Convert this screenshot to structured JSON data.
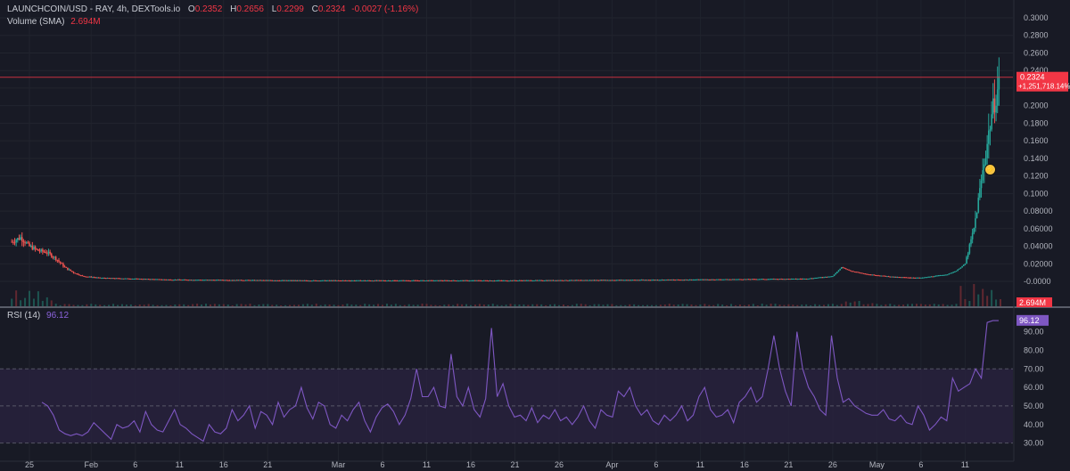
{
  "header": {
    "symbol": "LAUNCHCOIN/USD - RAY, 4h, DEXTools.io",
    "ohlc": [
      {
        "key": "O",
        "value": "0.2352"
      },
      {
        "key": "H",
        "value": "0.2656"
      },
      {
        "key": "L",
        "value": "0.2299"
      },
      {
        "key": "C",
        "value": "0.2324"
      }
    ],
    "change": "-0.0027 (-1.16%)",
    "volume_label": "Volume (SMA)",
    "volume_value": "2.694M",
    "rsi_label": "RSI (14)",
    "rsi_value": "96.12"
  },
  "price_axis": {
    "ticks": [
      "0.3000",
      "0.2800",
      "0.2600",
      "0.2400",
      "0.2200",
      "0.2000",
      "0.1800",
      "0.1600",
      "0.1400",
      "0.1200",
      "0.1000",
      "0.08000",
      "0.06000",
      "0.04000",
      "0.02000",
      "-0.0000"
    ],
    "current_price": "0.2324",
    "current_change": "+1,251,718.14%",
    "volume_badge": "2.694M"
  },
  "rsi_axis": {
    "ticks": [
      "90.00",
      "80.00",
      "70.00",
      "60.00",
      "50.00",
      "40.00",
      "30.00"
    ],
    "current": "96.12"
  },
  "time_axis": {
    "labels": [
      "25",
      "Feb",
      "6",
      "11",
      "16",
      "21",
      "Mar",
      "6",
      "11",
      "16",
      "21",
      "26",
      "Apr",
      "6",
      "11",
      "16",
      "21",
      "26",
      "May",
      "6",
      "11"
    ]
  },
  "colors": {
    "background": "#181a25",
    "up": "#26a69a",
    "down": "#ef5350",
    "rsi_line": "#7e57c2",
    "rsi_band": "#2a2340",
    "price_line": "#f23645"
  },
  "chart_data": [
    {
      "type": "candlestick",
      "title": "LAUNCHCOIN/USD - RAY, 4h, DEXTools.io",
      "x_labels": [
        "Jan 25",
        "Feb 1",
        "Feb 6",
        "Feb 11",
        "Feb 16",
        "Feb 21",
        "Mar 1",
        "Mar 6",
        "Mar 11",
        "Mar 16",
        "Mar 21",
        "Mar 26",
        "Apr 1",
        "Apr 6",
        "Apr 11",
        "Apr 16",
        "Apr 21",
        "Apr 26",
        "May 1",
        "May 6",
        "May 11"
      ],
      "ylim": [
        -0.01,
        0.31
      ],
      "series": [
        {
          "name": "LAUNCHCOIN/USD",
          "values": [
            {
              "x": "Jan 23",
              "y": 0.045
            },
            {
              "x": "Jan 24",
              "y": 0.05
            },
            {
              "x": "Jan 25",
              "y": 0.04
            },
            {
              "x": "Jan 26",
              "y": 0.035
            },
            {
              "x": "Jan 27",
              "y": 0.033
            },
            {
              "x": "Jan 28",
              "y": 0.026
            },
            {
              "x": "Jan 29",
              "y": 0.016
            },
            {
              "x": "Jan 30",
              "y": 0.01
            },
            {
              "x": "Jan 31",
              "y": 0.006
            },
            {
              "x": "Feb 2",
              "y": 0.004
            },
            {
              "x": "Feb 10",
              "y": 0.002
            },
            {
              "x": "Feb 25",
              "y": 0.001
            },
            {
              "x": "Mar 20",
              "y": 0.001
            },
            {
              "x": "Apr 10",
              "y": 0.002
            },
            {
              "x": "Apr 23",
              "y": 0.003
            },
            {
              "x": "Apr 26",
              "y": 0.006
            },
            {
              "x": "Apr 27",
              "y": 0.016
            },
            {
              "x": "Apr 28",
              "y": 0.012
            },
            {
              "x": "Apr 30",
              "y": 0.008
            },
            {
              "x": "May 3",
              "y": 0.005
            },
            {
              "x": "May 6",
              "y": 0.004
            },
            {
              "x": "May 9",
              "y": 0.008
            },
            {
              "x": "May 10",
              "y": 0.012
            },
            {
              "x": "May 11",
              "y": 0.02
            },
            {
              "x": "May 12",
              "y": 0.06
            },
            {
              "x": "May 13",
              "y": 0.125
            },
            {
              "x": "May 14",
              "y": 0.19
            },
            {
              "x": "May 15",
              "y": 0.2324
            }
          ]
        }
      ]
    },
    {
      "type": "line",
      "title": "RSI (14)",
      "ylim": [
        25,
        98
      ],
      "bands": {
        "upper": 70,
        "middle": 50,
        "lower": 30
      },
      "series": [
        {
          "name": "RSI (14)",
          "values": [
            52,
            50,
            45,
            37,
            35,
            34,
            35,
            34,
            36,
            41,
            38,
            35,
            32,
            40,
            38,
            39,
            42,
            36,
            47,
            40,
            37,
            36,
            42,
            48,
            40,
            38,
            35,
            33,
            31,
            40,
            36,
            35,
            38,
            48,
            42,
            45,
            50,
            38,
            47,
            45,
            40,
            52,
            44,
            48,
            50,
            60,
            49,
            43,
            52,
            50,
            40,
            38,
            45,
            42,
            48,
            52,
            42,
            36,
            44,
            49,
            51,
            47,
            40,
            45,
            54,
            70,
            55,
            55,
            60,
            50,
            49,
            78,
            55,
            50,
            60,
            48,
            44,
            54,
            92,
            55,
            62,
            50,
            44,
            45,
            42,
            49,
            41,
            45,
            43,
            48,
            42,
            44,
            40,
            44,
            50,
            42,
            38,
            48,
            45,
            44,
            58,
            55,
            60,
            50,
            45,
            48,
            42,
            40,
            45,
            42,
            45,
            50,
            42,
            45,
            55,
            60,
            48,
            44,
            45,
            48,
            41,
            52,
            55,
            60,
            52,
            55,
            70,
            88,
            70,
            58,
            50,
            90,
            70,
            60,
            55,
            48,
            45,
            88,
            65,
            52,
            54,
            50,
            48,
            46,
            45,
            45,
            48,
            43,
            42,
            45,
            41,
            40,
            50,
            45,
            37,
            40,
            44,
            42,
            65,
            58,
            60,
            62,
            70,
            65,
            95,
            96,
            96
          ]
        }
      ]
    }
  ]
}
